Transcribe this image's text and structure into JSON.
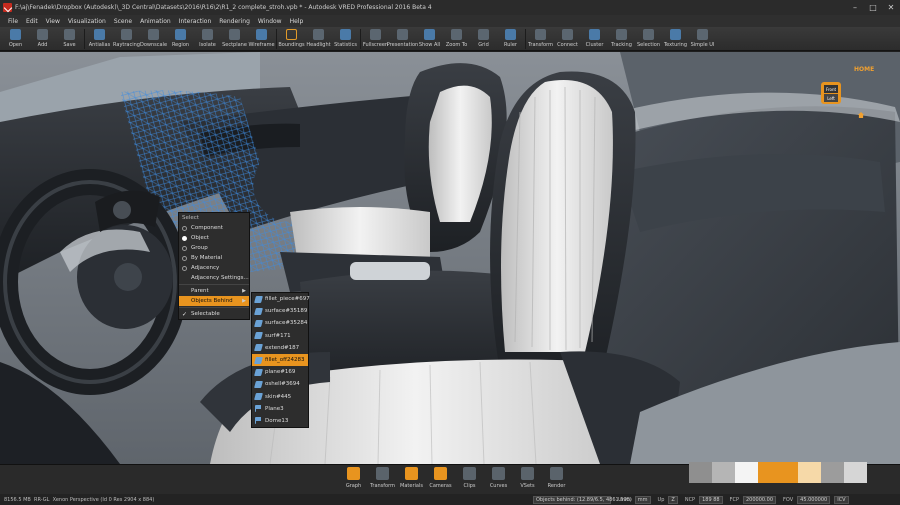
{
  "window": {
    "title": "F:\\aj\\Fenadek\\Dropbox (Autodesk)\\_3D Central\\Datasets\\2016\\R16\\2\\R1_2 complete_stroh.vpb * - Autodesk VRED Professional 2016 Beta 4",
    "minimize": "–",
    "maximize": "□",
    "close": "✕"
  },
  "menu": [
    "File",
    "Edit",
    "View",
    "Visualization",
    "Scene",
    "Animation",
    "Interaction",
    "Rendering",
    "Window",
    "Help"
  ],
  "toolbar": [
    {
      "label": "Open",
      "icon": "folder-icon"
    },
    {
      "label": "Add",
      "icon": "add-icon"
    },
    {
      "label": "Save",
      "icon": "save-icon"
    },
    {
      "label": "Antialias",
      "icon": "antialias-icon"
    },
    {
      "label": "Raytracing",
      "icon": "raytracing-icon"
    },
    {
      "label": "Downscale",
      "icon": "downscale-icon"
    },
    {
      "label": "Region",
      "icon": "region-icon"
    },
    {
      "label": "Isolate",
      "icon": "isolate-icon"
    },
    {
      "label": "Sectplane",
      "icon": "sectplane-icon"
    },
    {
      "label": "Wireframe",
      "icon": "wireframe-icon"
    },
    {
      "label": "Boundings",
      "icon": "boundings-icon",
      "active": true
    },
    {
      "label": "Headlight",
      "icon": "headlight-icon"
    },
    {
      "label": "Statistics",
      "icon": "statistics-icon"
    },
    {
      "label": "Fullscreen",
      "icon": "fullscreen-icon"
    },
    {
      "label": "Presentation",
      "icon": "presentation-icon"
    },
    {
      "label": "Show All",
      "icon": "show-all-icon"
    },
    {
      "label": "Zoom To",
      "icon": "zoom-to-icon"
    },
    {
      "label": "Grid",
      "icon": "grid-icon"
    },
    {
      "label": "Ruler",
      "icon": "ruler-icon"
    },
    {
      "label": "Transform",
      "icon": "transform-icon"
    },
    {
      "label": "Connect",
      "icon": "connect-icon"
    },
    {
      "label": "Cluster",
      "icon": "cluster-icon"
    },
    {
      "label": "Tracking",
      "icon": "tracking-icon"
    },
    {
      "label": "Selection",
      "icon": "selection-icon"
    },
    {
      "label": "Texturing",
      "icon": "texturing-icon"
    },
    {
      "label": "Simple UI",
      "icon": "simple-ui-icon"
    }
  ],
  "navcube": {
    "home": "HOME",
    "front": "Front",
    "left": "Left"
  },
  "context_menu": {
    "header": "Select",
    "items": [
      {
        "label": "Component",
        "type": "radio",
        "checked": false
      },
      {
        "label": "Object",
        "type": "radio",
        "checked": true
      },
      {
        "label": "Group",
        "type": "radio",
        "checked": false
      },
      {
        "label": "By Material",
        "type": "radio",
        "checked": false
      },
      {
        "label": "Adjacency",
        "type": "radio",
        "checked": false
      },
      {
        "label": "Adjacency Settings...",
        "type": "plain"
      },
      {
        "label": "Parent",
        "type": "submenu"
      },
      {
        "label": "Objects Behind",
        "type": "submenu",
        "highlight": true
      },
      {
        "label": "Selectable",
        "type": "check",
        "checked": true
      }
    ],
    "check_mark": "✓",
    "arrow": "▶"
  },
  "submenu": {
    "items": [
      {
        "label": "fillet_piece#697",
        "icon": "surface-icon"
      },
      {
        "label": "surface#35189",
        "icon": "surface-icon"
      },
      {
        "label": "surface#35284",
        "icon": "surface-icon"
      },
      {
        "label": "surf#171",
        "icon": "surface-icon"
      },
      {
        "label": "extend#187",
        "icon": "surface-icon"
      },
      {
        "label": "fillet_off24283",
        "icon": "surface-icon",
        "highlight": true
      },
      {
        "label": "plane#169",
        "icon": "surface-icon"
      },
      {
        "label": "oshell#3694",
        "icon": "surface-icon"
      },
      {
        "label": "skin#445",
        "icon": "surface-icon"
      },
      {
        "label": "Plane3",
        "icon": "plane-flag-icon"
      },
      {
        "label": "Dome13",
        "icon": "plane-flag-icon"
      }
    ]
  },
  "dock": [
    {
      "label": "Graph",
      "icon": "graph-icon",
      "active": true
    },
    {
      "label": "Transform",
      "icon": "transform-dock-icon"
    },
    {
      "label": "Materials",
      "icon": "materials-icon",
      "active": true
    },
    {
      "label": "Cameras",
      "icon": "cameras-icon",
      "active": true
    },
    {
      "label": "Clips",
      "icon": "clips-icon"
    },
    {
      "label": "Curves",
      "icon": "curves-icon"
    },
    {
      "label": "VSets",
      "icon": "vsets-icon"
    },
    {
      "label": "Render",
      "icon": "render-icon"
    }
  ],
  "swatches": [
    "#8f8f8f",
    "#b5b5b5",
    "#f4f4f4",
    "#e8941f",
    "#f6d9a8",
    "#9c9c9c",
    "#d6d6d6"
  ],
  "status": {
    "memory": "8156.5 MB",
    "renderer": "RR-GL",
    "view": "Xenon Perspective (Id 0 Res 2904 x 884)",
    "message": "Objects behind: (12.89/6.5, 4861.698)",
    "units_label": "Units",
    "units_value": "mm",
    "up_label": "Up",
    "up_value": "Z",
    "ncp_label": "NCP",
    "ncp_value": "189 88",
    "fcp_label": "FCP",
    "fcp_value": "200000.00",
    "fov_label": "FOV",
    "fov_value": "45.000000",
    "icv": "ICV"
  },
  "colors": {
    "accent": "#e8941f",
    "menu_bg": "#2d2d2d",
    "selection_blue": "#3d8be0"
  }
}
